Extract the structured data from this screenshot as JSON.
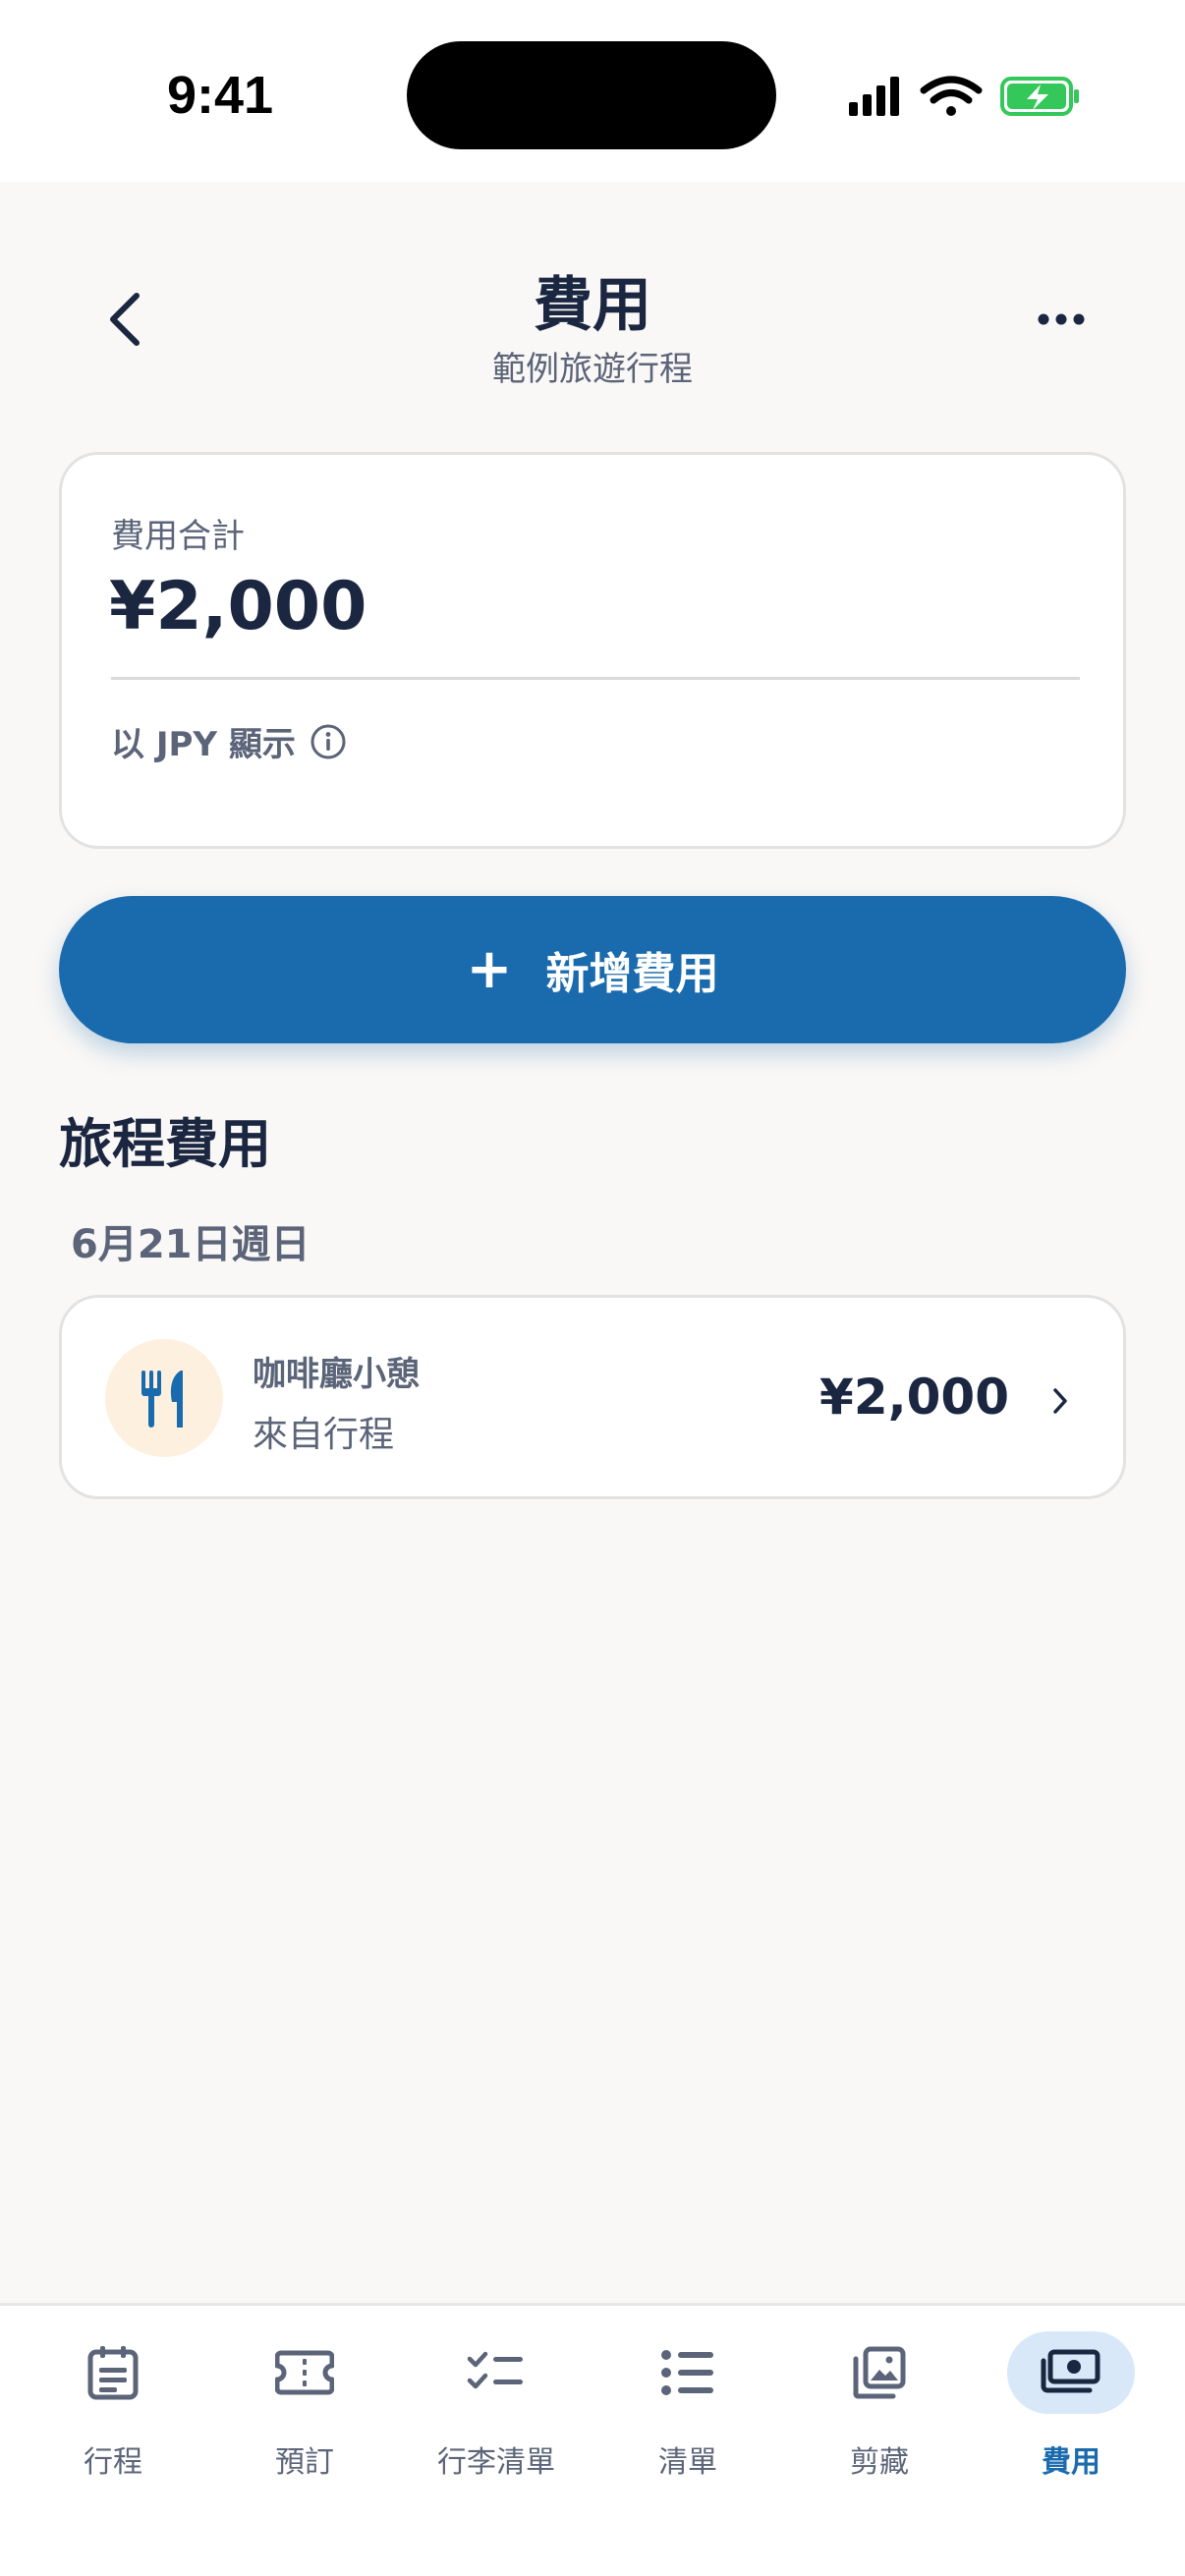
{
  "status_bar": {
    "time": "9:41"
  },
  "header": {
    "title": "費用",
    "subtitle": "範例旅遊行程",
    "back_icon": "chevron-left-icon",
    "more_icon": "ellipsis-icon"
  },
  "summary": {
    "label": "費用合計",
    "amount": "¥2,000",
    "currency_note": "以 JPY 顯示"
  },
  "add_button": {
    "label": "新增費用"
  },
  "section": {
    "title": "旅程費用",
    "groups": [
      {
        "date": "6月21日週日",
        "items": [
          {
            "name": "咖啡廳小憩",
            "source": "來自行程",
            "amount": "¥2,000",
            "icon": "fork-knife-icon"
          }
        ]
      }
    ]
  },
  "tabs": [
    {
      "label": "行程",
      "icon": "itinerary-icon",
      "active": false
    },
    {
      "label": "預訂",
      "icon": "ticket-icon",
      "active": false
    },
    {
      "label": "行李清單",
      "icon": "checklist-icon",
      "active": false
    },
    {
      "label": "清單",
      "icon": "list-icon",
      "active": false
    },
    {
      "label": "剪藏",
      "icon": "gallery-icon",
      "active": false
    },
    {
      "label": "費用",
      "icon": "cash-icon",
      "active": true
    }
  ],
  "colors": {
    "accent": "#1A6BAD",
    "text_primary": "#1B2640",
    "text_secondary": "#5B6478",
    "background": "#FAF8F6",
    "category_badge": "#FDF0DE",
    "battery": "#34C759"
  }
}
